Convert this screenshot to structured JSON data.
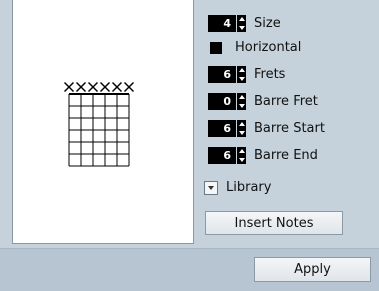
{
  "controls": {
    "size": {
      "value": "4",
      "label": "Size"
    },
    "horizontal": {
      "label": "Horizontal",
      "checked": true
    },
    "frets": {
      "value": "6",
      "label": "Frets"
    },
    "barre_fret": {
      "value": "0",
      "label": "Barre Fret"
    },
    "barre_start": {
      "value": "6",
      "label": "Barre Start"
    },
    "barre_end": {
      "value": "6",
      "label": "Barre End"
    },
    "library": {
      "label": "Library"
    }
  },
  "buttons": {
    "insert_notes": "Insert Notes",
    "apply": "Apply"
  },
  "chord_diagram": {
    "strings": 6,
    "frets": 6,
    "string_markers": [
      "x",
      "x",
      "x",
      "x",
      "x",
      "x"
    ]
  },
  "colors": {
    "panel": "#c5d2dc",
    "footer": "#b6c5d1",
    "preview_bg": "#ffffff",
    "value_box": "#000000"
  }
}
